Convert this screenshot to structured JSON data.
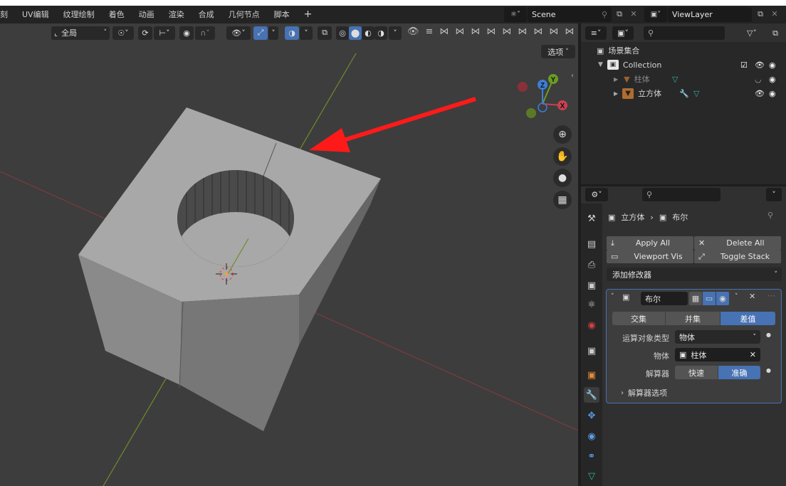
{
  "menubar": {
    "items": [
      "刻",
      "UV编辑",
      "纹理绘制",
      "着色",
      "动画",
      "渲染",
      "合成",
      "几何节点",
      "脚本"
    ],
    "add_tab": "+"
  },
  "scene": {
    "name": "Scene"
  },
  "view_layer": {
    "name": "ViewLayer"
  },
  "viewport": {
    "transform_orientation": "全局",
    "options_label": "选项",
    "gizmo_axes": [
      "X",
      "Y",
      "Z"
    ]
  },
  "outliner": {
    "root_label": "场景集合",
    "collection_label": "Collection",
    "objects": [
      {
        "name": "柱体",
        "hidden": true
      },
      {
        "name": "立方体",
        "hidden": false
      }
    ]
  },
  "properties": {
    "breadcrumb": {
      "object": "立方体",
      "modifier": "布尔"
    },
    "apply_all_label": "Apply All",
    "delete_all_label": "Delete All",
    "viewport_vis_label": "Viewport Vis",
    "toggle_stack_label": "Toggle Stack",
    "add_modifier_label": "添加修改器",
    "modifier": {
      "name": "布尔",
      "operations": [
        "交集",
        "并集",
        "差值"
      ],
      "active_operation": "差值",
      "operand_type_label": "运算对象类型",
      "operand_type_value": "物体",
      "object_label": "物体",
      "object_value": "柱体",
      "solver_label": "解算器",
      "solver_options": [
        "快速",
        "准确"
      ],
      "active_solver": "准确",
      "solver_options_label": "解算器选项"
    }
  },
  "colors": {
    "accent": "#4772b3",
    "axis_x": "#c84150",
    "axis_y": "#6b9c23",
    "axis_z": "#3d7fd6",
    "annotation_arrow": "#ff1a1a"
  }
}
